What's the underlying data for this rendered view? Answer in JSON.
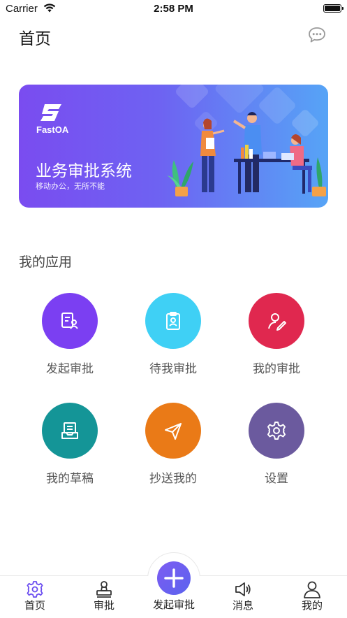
{
  "status": {
    "carrier": "Carrier",
    "time": "2:58 PM"
  },
  "header": {
    "title": "首页",
    "chat_icon": "chat-bubble-icon"
  },
  "banner": {
    "brand": "FastOA",
    "title": "业务审批系统",
    "subtitle": "移动办公，无所不能",
    "gradient": [
      "#7a4cf0",
      "#56a4f6"
    ]
  },
  "section": {
    "title": "我的应用"
  },
  "apps": [
    {
      "label": "发起审批",
      "icon": "document-user-icon",
      "color": "#7b3ff2"
    },
    {
      "label": "待我审批",
      "icon": "clipboard-badge-icon",
      "color": "#3fd0f5"
    },
    {
      "label": "我的审批",
      "icon": "user-edit-icon",
      "color": "#e0284f"
    },
    {
      "label": "我的草稿",
      "icon": "draft-tray-icon",
      "color": "#149597"
    },
    {
      "label": "抄送我的",
      "icon": "paper-plane-icon",
      "color": "#ea7a17"
    },
    {
      "label": "设置",
      "icon": "gear-icon",
      "color": "#6b5a9e"
    }
  ],
  "tabbar": {
    "items": [
      {
        "label": "首页",
        "icon": "home-gear-icon",
        "active": true
      },
      {
        "label": "审批",
        "icon": "stamp-icon"
      },
      {
        "label": "发起审批",
        "icon": "plus-icon"
      },
      {
        "label": "消息",
        "icon": "speaker-icon"
      },
      {
        "label": "我的",
        "icon": "person-icon"
      }
    ],
    "accent": "#6a4cf0"
  }
}
